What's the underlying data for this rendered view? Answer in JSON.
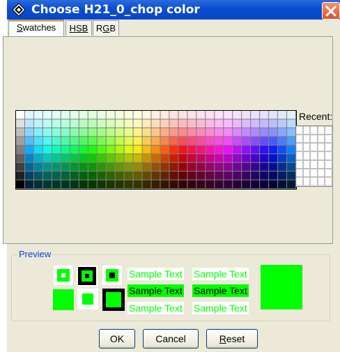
{
  "window": {
    "title": "Choose H21_0_chop color",
    "title_icon": "java-app-icon",
    "close_icon": "close-icon"
  },
  "tabs": [
    {
      "label": "Swatches",
      "mnemonic": "S",
      "active": true
    },
    {
      "label": "HSB",
      "mnemonic": "H",
      "active": false
    },
    {
      "label": "RGB",
      "mnemonic": "G",
      "active": false
    }
  ],
  "swatches": {
    "columns": 31,
    "rows": 9,
    "recent_label": "Recent:",
    "recent_columns": 5,
    "recent_rows": 7
  },
  "preview": {
    "label": "Preview",
    "sample_text": "Sample Text",
    "color": "#00ff00",
    "color_name": "green"
  },
  "buttons": {
    "ok": "OK",
    "cancel": "Cancel",
    "reset": "Reset",
    "reset_mnemonic": "R"
  },
  "colors": {
    "title_bar": "#0a4dd1",
    "dialog_bg": "#ece9d8",
    "preview_label": "#0046d5",
    "active_tab_accent": "#e4a93c"
  }
}
